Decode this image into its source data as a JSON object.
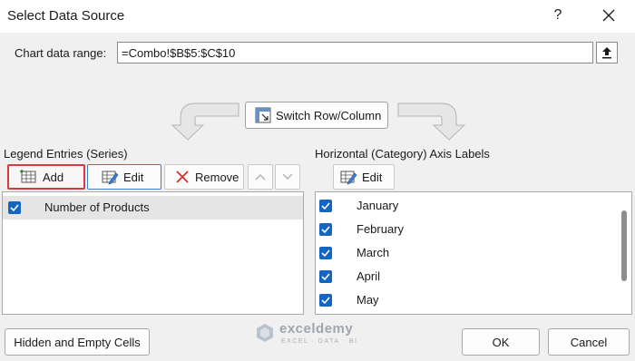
{
  "window": {
    "title": "Select Data Source",
    "help_label": "?"
  },
  "range": {
    "label": "Chart data range:",
    "value": "=Combo!$B$5:$C$10"
  },
  "switch_button": {
    "label": "Switch Row/Column"
  },
  "legend": {
    "label": "Legend Entries (Series)",
    "add_label": "Add",
    "edit_label": "Edit",
    "remove_label": "Remove",
    "series": [
      {
        "name": "Number of Products",
        "checked": true
      }
    ]
  },
  "axis": {
    "label": "Horizontal (Category) Axis Labels",
    "edit_label": "Edit",
    "items": [
      {
        "label": "January",
        "checked": true
      },
      {
        "label": "February",
        "checked": true
      },
      {
        "label": "March",
        "checked": true
      },
      {
        "label": "April",
        "checked": true
      },
      {
        "label": "May",
        "checked": true
      }
    ]
  },
  "footer": {
    "hidden_label": "Hidden and Empty Cells",
    "ok_label": "OK",
    "cancel_label": "Cancel"
  },
  "watermark": {
    "name": "exceldemy",
    "tagline": "EXCEL · DATA · BI"
  },
  "colors": {
    "checkbox": "#1565c0",
    "highlight_border": "#d63a3a",
    "selected_row": "#e5e5e5"
  }
}
